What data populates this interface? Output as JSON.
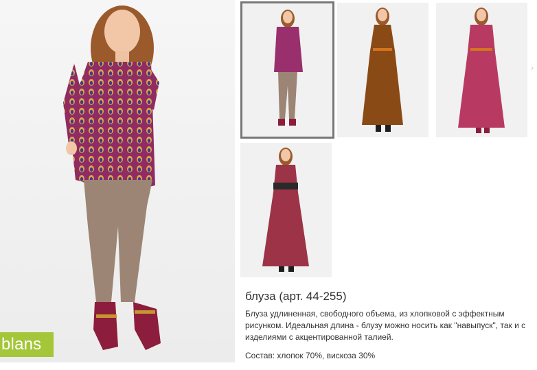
{
  "brand": {
    "logo_text": "blans",
    "color": "#a4c639"
  },
  "product": {
    "title": "блуза (арт. 44-255)",
    "description": "Блуза удлиненная, свободного объема, из хлопковой с эффектным рисунком. Идеальная длина - блузу можно носить как \"навыпуск\", так и с изделиями с акцентированной талией.",
    "composition": "Состав: хлопок 70%, вискоза 30%"
  },
  "gallery": {
    "selected_index": 0,
    "thumbnails": [
      {
        "name": "thumbnail-blouse",
        "garment": "blouse"
      },
      {
        "name": "thumbnail-brown-maxi-dress",
        "garment": "dress"
      },
      {
        "name": "thumbnail-red-maxi-dress",
        "garment": "dress"
      },
      {
        "name": "thumbnail-ikat-maxi-dress",
        "garment": "dress"
      }
    ],
    "next_arrow_icon": "chevron-right-icon"
  },
  "colors": {
    "thumbnail_selected_border": "#777777",
    "text": "#333333"
  }
}
